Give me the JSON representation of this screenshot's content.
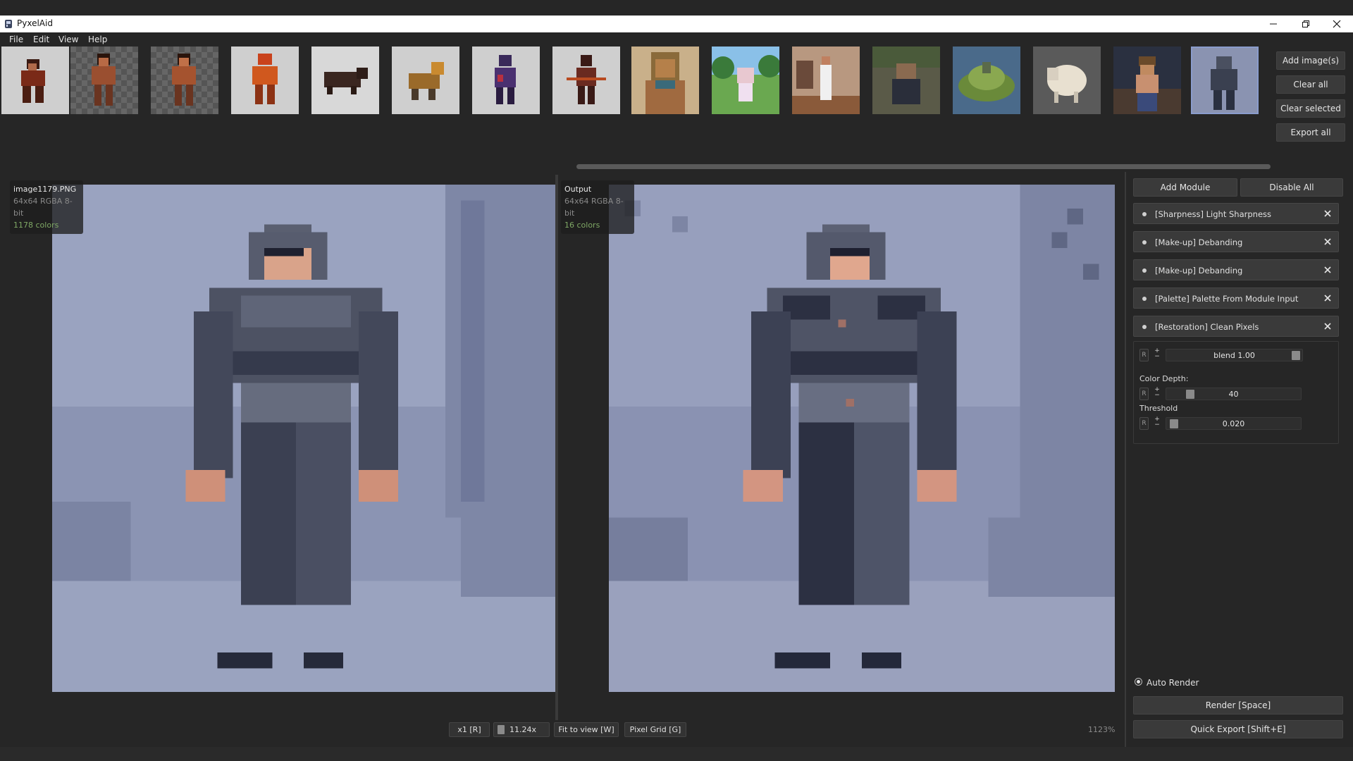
{
  "window": {
    "title": "PyxelAid"
  },
  "menu": [
    "File",
    "Edit",
    "View",
    "Help"
  ],
  "sidebar_buttons": {
    "add": "Add image(s)",
    "clear_all": "Clear all",
    "clear_selected": "Clear selected",
    "export_all": "Export all"
  },
  "thumbnails": [
    {
      "label": "thumb-1",
      "bg": "light"
    },
    {
      "label": "thumb-2",
      "bg": "checker"
    },
    {
      "label": "thumb-3",
      "bg": "checker"
    },
    {
      "label": "thumb-4",
      "bg": "light"
    },
    {
      "label": "thumb-5",
      "bg": "light"
    },
    {
      "label": "thumb-6",
      "bg": "light"
    },
    {
      "label": "thumb-7",
      "bg": "light"
    },
    {
      "label": "thumb-8",
      "bg": "light"
    },
    {
      "label": "thumb-9",
      "bg": "scene"
    },
    {
      "label": "thumb-10",
      "bg": "scene"
    },
    {
      "label": "thumb-11",
      "bg": "scene"
    },
    {
      "label": "thumb-12",
      "bg": "scene"
    },
    {
      "label": "thumb-13",
      "bg": "scene"
    },
    {
      "label": "thumb-14",
      "bg": "scene"
    },
    {
      "label": "thumb-15",
      "bg": "scene"
    },
    {
      "label": "thumb-16",
      "bg": "scene",
      "selected": true
    }
  ],
  "input_image": {
    "name": "image1179.PNG",
    "meta": "64x64  RGBA  8-bit",
    "colors": "1178 colors"
  },
  "output_image": {
    "name": "Output",
    "meta": "64x64  RGBA  8-bit",
    "colors": "16 colors"
  },
  "bottom_toolbar": {
    "scale": "x1 [R]",
    "zoom_value": "11.24x",
    "fit": "Fit to view [W]",
    "grid": "Pixel Grid [G]",
    "zoom_percent": "1123%"
  },
  "right_panel": {
    "add_module": "Add Module",
    "disable_all": "Disable All",
    "modules": [
      "[Sharpness] Light Sharpness",
      "[Make-up] Debanding",
      "[Make-up] Debanding",
      "[Palette] Palette From Module Input",
      "[Restoration] Clean Pixels"
    ],
    "settings": {
      "r": "R",
      "blend": "blend 1.00",
      "color_depth_label": "Color Depth:",
      "color_depth_value": "40",
      "threshold_label": "Threshold",
      "threshold_value": "0.020"
    },
    "auto_render": "Auto Render",
    "render": "Render  [Space]",
    "quick_export": "Quick Export  [Shift+E]"
  },
  "colors": {
    "bg": "#262626",
    "panel": "#3a3a3a",
    "scene_blue": "#8a93b1",
    "accent_green": "#7fa865"
  }
}
